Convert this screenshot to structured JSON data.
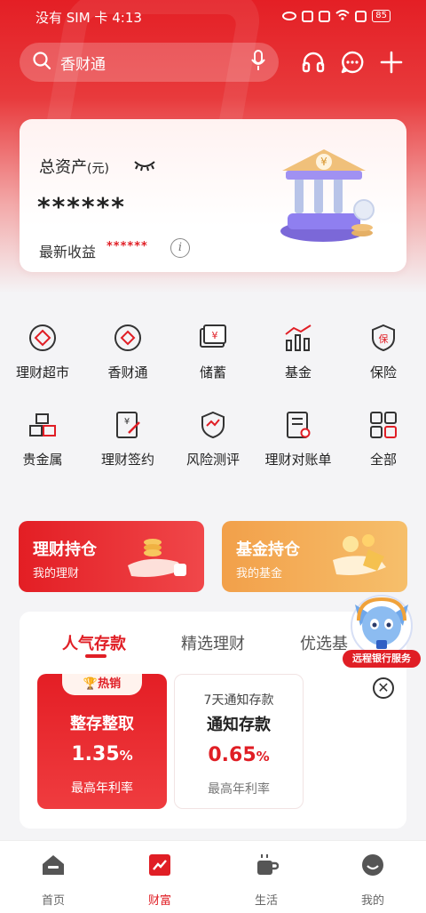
{
  "status_bar": {
    "carrier": "没有 SIM 卡",
    "time": "4:13",
    "battery": "85"
  },
  "search": {
    "placeholder": "香财通"
  },
  "top_actions": [
    "headset-icon",
    "message-icon",
    "plus-icon"
  ],
  "asset_card": {
    "title": "总资产",
    "unit": "(元)",
    "value": "******",
    "income_label": "最新收益",
    "income_value": "******",
    "info": "i"
  },
  "grid": [
    {
      "label": "理财超市",
      "icon": "finance-market-icon"
    },
    {
      "label": "香财通",
      "icon": "xiangcaitong-icon"
    },
    {
      "label": "储蓄",
      "icon": "savings-icon"
    },
    {
      "label": "基金",
      "icon": "fund-icon"
    },
    {
      "label": "保险",
      "icon": "insurance-icon"
    },
    {
      "label": "贵金属",
      "icon": "precious-metal-icon"
    },
    {
      "label": "理财签约",
      "icon": "contract-icon"
    },
    {
      "label": "风险测评",
      "icon": "risk-assessment-icon"
    },
    {
      "label": "理财对账单",
      "icon": "statement-icon"
    },
    {
      "label": "全部",
      "icon": "all-apps-icon"
    }
  ],
  "holdings": [
    {
      "title": "理财持仓",
      "subtitle": "我的理财"
    },
    {
      "title": "基金持仓",
      "subtitle": "我的基金"
    }
  ],
  "tabs": [
    {
      "label": "人气存款",
      "active": true
    },
    {
      "label": "精选理财",
      "active": false
    },
    {
      "label": "优选基",
      "active": false
    }
  ],
  "products": [
    {
      "badge": "热销",
      "name": "整存整取",
      "rate": "1.35",
      "rate_unit": "%",
      "rate_label": "最高年利率"
    },
    {
      "top": "7天通知存款",
      "name": "通知存款",
      "rate": "0.65",
      "rate_unit": "%",
      "rate_label": "最高年利率"
    }
  ],
  "mascot": {
    "label": "远程银行服务"
  },
  "close": "✕",
  "bottom_nav": [
    {
      "label": "首页",
      "active": false
    },
    {
      "label": "财富",
      "active": true
    },
    {
      "label": "生活",
      "active": false
    },
    {
      "label": "我的",
      "active": false
    }
  ],
  "colors": {
    "brand_red": "#e01e25",
    "orange": "#f2a04a"
  }
}
